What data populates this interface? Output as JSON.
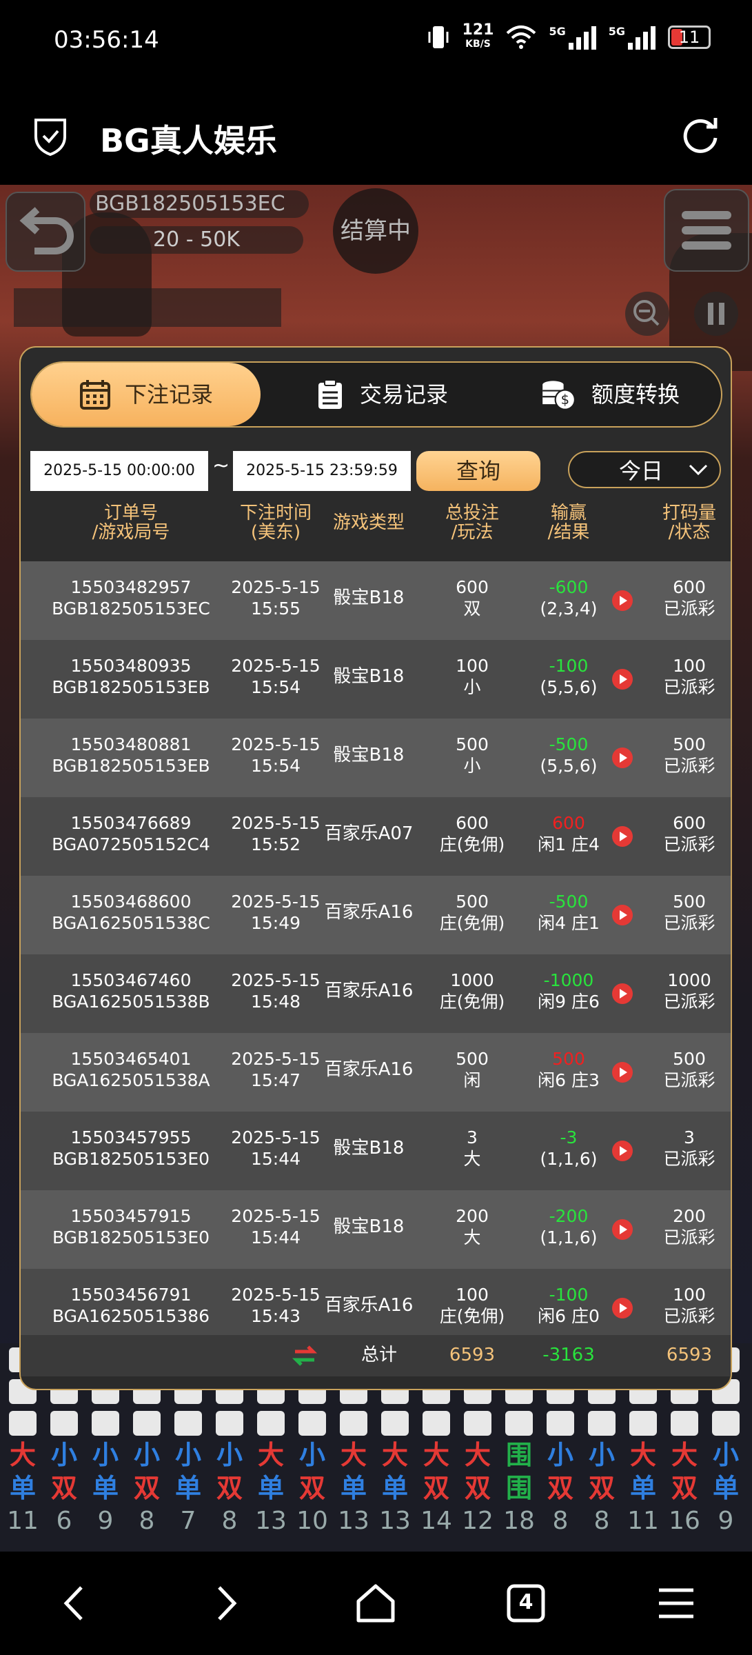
{
  "status": {
    "time": "03:56:14",
    "speed": "121",
    "speed_unit": "KB/S",
    "net1": "5G",
    "net2": "5G",
    "battery": "11"
  },
  "header": {
    "title": "BG真人娱乐"
  },
  "game": {
    "table_id": "BGB182505153EC",
    "limit": "20 - 50K",
    "settling": "结算中"
  },
  "tabs": [
    {
      "label": "下注记录",
      "icon": "calendar-icon",
      "active": true
    },
    {
      "label": "交易记录",
      "icon": "clipboard-icon",
      "active": false
    },
    {
      "label": "额度转换",
      "icon": "coins-icon",
      "active": false
    }
  ],
  "filter": {
    "start": "2025-5-15 00:00:00",
    "tilde": "~",
    "end": "2025-5-15 23:59:59",
    "query_label": "查询",
    "range_label": "今日"
  },
  "table": {
    "headers": [
      {
        "l1": "订单号",
        "l2": "/游戏局号"
      },
      {
        "l1": "下注时间",
        "l2": "(美东)"
      },
      {
        "l1": "游戏类型",
        "l2": ""
      },
      {
        "l1": "总投注",
        "l2": "/玩法"
      },
      {
        "l1": "输赢",
        "l2": "/结果"
      },
      {
        "l1": "打码量",
        "l2": "/状态"
      }
    ],
    "rows": [
      {
        "order": "15503482957",
        "round": "BGB182505153EC",
        "date": "2025-5-15",
        "time": "15:55",
        "game": "骰宝B18",
        "bet": "600",
        "play": "双",
        "winloss": "-600",
        "wl_color": "green",
        "result": "(2,3,4)",
        "valid": "600",
        "status": "已派彩"
      },
      {
        "order": "15503480935",
        "round": "BGB182505153EB",
        "date": "2025-5-15",
        "time": "15:54",
        "game": "骰宝B18",
        "bet": "100",
        "play": "小",
        "winloss": "-100",
        "wl_color": "green",
        "result": "(5,5,6)",
        "valid": "100",
        "status": "已派彩"
      },
      {
        "order": "15503480881",
        "round": "BGB182505153EB",
        "date": "2025-5-15",
        "time": "15:54",
        "game": "骰宝B18",
        "bet": "500",
        "play": "小",
        "winloss": "-500",
        "wl_color": "green",
        "result": "(5,5,6)",
        "valid": "500",
        "status": "已派彩"
      },
      {
        "order": "15503476689",
        "round": "BGA072505152C4",
        "date": "2025-5-15",
        "time": "15:52",
        "game": "百家乐A07",
        "bet": "600",
        "play": "庄(免佣)",
        "winloss": "600",
        "wl_color": "red",
        "result": "闲1 庄4",
        "valid": "600",
        "status": "已派彩"
      },
      {
        "order": "15503468600",
        "round": "BGA1625051538C",
        "date": "2025-5-15",
        "time": "15:49",
        "game": "百家乐A16",
        "bet": "500",
        "play": "庄(免佣)",
        "winloss": "-500",
        "wl_color": "green",
        "result": "闲4 庄1",
        "valid": "500",
        "status": "已派彩"
      },
      {
        "order": "15503467460",
        "round": "BGA1625051538B",
        "date": "2025-5-15",
        "time": "15:48",
        "game": "百家乐A16",
        "bet": "1000",
        "play": "庄(免佣)",
        "winloss": "-1000",
        "wl_color": "green",
        "result": "闲9 庄6",
        "valid": "1000",
        "status": "已派彩"
      },
      {
        "order": "15503465401",
        "round": "BGA1625051538A",
        "date": "2025-5-15",
        "time": "15:47",
        "game": "百家乐A16",
        "bet": "500",
        "play": "闲",
        "winloss": "500",
        "wl_color": "red",
        "result": "闲6 庄3",
        "valid": "500",
        "status": "已派彩"
      },
      {
        "order": "15503457955",
        "round": "BGB182505153E0",
        "date": "2025-5-15",
        "time": "15:44",
        "game": "骰宝B18",
        "bet": "3",
        "play": "大",
        "winloss": "-3",
        "wl_color": "green",
        "result": "(1,1,6)",
        "valid": "3",
        "status": "已派彩"
      },
      {
        "order": "15503457915",
        "round": "BGB182505153E0",
        "date": "2025-5-15",
        "time": "15:44",
        "game": "骰宝B18",
        "bet": "200",
        "play": "大",
        "winloss": "-200",
        "wl_color": "green",
        "result": "(1,1,6)",
        "valid": "200",
        "status": "已派彩"
      },
      {
        "order": "15503456791",
        "round": "BGA16250515386",
        "date": "2025-5-15",
        "time": "15:43",
        "game": "百家乐A16",
        "bet": "100",
        "play": "庄(免佣)",
        "winloss": "-100",
        "wl_color": "green",
        "result": "闲6 庄0",
        "valid": "100",
        "status": "已派彩"
      }
    ],
    "total": {
      "label": "总计",
      "bet": "6593",
      "winloss": "-3163",
      "valid": "6593"
    }
  },
  "roadmap": [
    {
      "a": "大",
      "b": "单",
      "n": "11",
      "ca": "#e53935",
      "cb": "#2f7fe0"
    },
    {
      "a": "小",
      "b": "双",
      "n": "6",
      "ca": "#2f7fe0",
      "cb": "#e53935"
    },
    {
      "a": "小",
      "b": "单",
      "n": "9",
      "ca": "#2f7fe0",
      "cb": "#2f7fe0"
    },
    {
      "a": "小",
      "b": "双",
      "n": "8",
      "ca": "#2f7fe0",
      "cb": "#e53935"
    },
    {
      "a": "小",
      "b": "单",
      "n": "7",
      "ca": "#2f7fe0",
      "cb": "#2f7fe0"
    },
    {
      "a": "小",
      "b": "双",
      "n": "8",
      "ca": "#2f7fe0",
      "cb": "#e53935"
    },
    {
      "a": "大",
      "b": "单",
      "n": "13",
      "ca": "#e53935",
      "cb": "#2f7fe0"
    },
    {
      "a": "小",
      "b": "双",
      "n": "10",
      "ca": "#2f7fe0",
      "cb": "#e53935"
    },
    {
      "a": "大",
      "b": "单",
      "n": "13",
      "ca": "#e53935",
      "cb": "#2f7fe0"
    },
    {
      "a": "大",
      "b": "单",
      "n": "13",
      "ca": "#e53935",
      "cb": "#2f7fe0"
    },
    {
      "a": "大",
      "b": "双",
      "n": "14",
      "ca": "#e53935",
      "cb": "#e53935"
    },
    {
      "a": "大",
      "b": "双",
      "n": "12",
      "ca": "#e53935",
      "cb": "#e53935"
    },
    {
      "a": "围",
      "b": "围",
      "n": "18",
      "ca": "#22b04a",
      "cb": "#22b04a"
    },
    {
      "a": "小",
      "b": "双",
      "n": "8",
      "ca": "#2f7fe0",
      "cb": "#e53935"
    },
    {
      "a": "小",
      "b": "双",
      "n": "8",
      "ca": "#2f7fe0",
      "cb": "#e53935"
    },
    {
      "a": "大",
      "b": "单",
      "n": "11",
      "ca": "#e53935",
      "cb": "#2f7fe0"
    },
    {
      "a": "大",
      "b": "双",
      "n": "16",
      "ca": "#e53935",
      "cb": "#e53935"
    },
    {
      "a": "小",
      "b": "单",
      "n": "9",
      "ca": "#2f7fe0",
      "cb": "#2f7fe0"
    }
  ],
  "navbar": {
    "tab_count": "4"
  }
}
